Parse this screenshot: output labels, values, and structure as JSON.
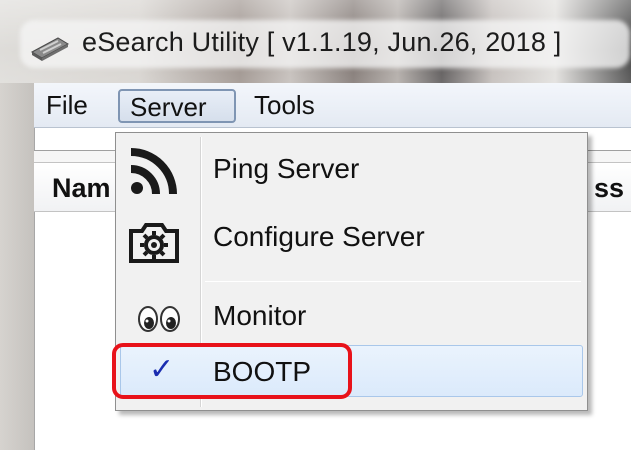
{
  "window": {
    "title": "eSearch Utility [ v1.1.19, Jun.26, 2018 ]",
    "icon": "network-card-icon"
  },
  "menubar": {
    "items": [
      {
        "label": "File"
      },
      {
        "label": "Server"
      },
      {
        "label": "Tools"
      }
    ],
    "open_menu": "Server"
  },
  "list": {
    "columns": [
      "Nam",
      "ss"
    ]
  },
  "server_menu": {
    "items": [
      {
        "label": "Ping Server",
        "icon": "signal-waves-icon"
      },
      {
        "label": "Configure Server",
        "icon": "gear-camera-icon"
      },
      {
        "label": "Monitor",
        "icon": "eyes-icon"
      },
      {
        "label": "BOOTP",
        "icon": "check-icon",
        "checked": true,
        "check_glyph": "✓"
      }
    ]
  },
  "annotation": {
    "highlight": "BOOTP",
    "color": "#e8121a"
  },
  "colors": {
    "menu_hover": "#dbeafb",
    "check": "#1a2db0"
  }
}
